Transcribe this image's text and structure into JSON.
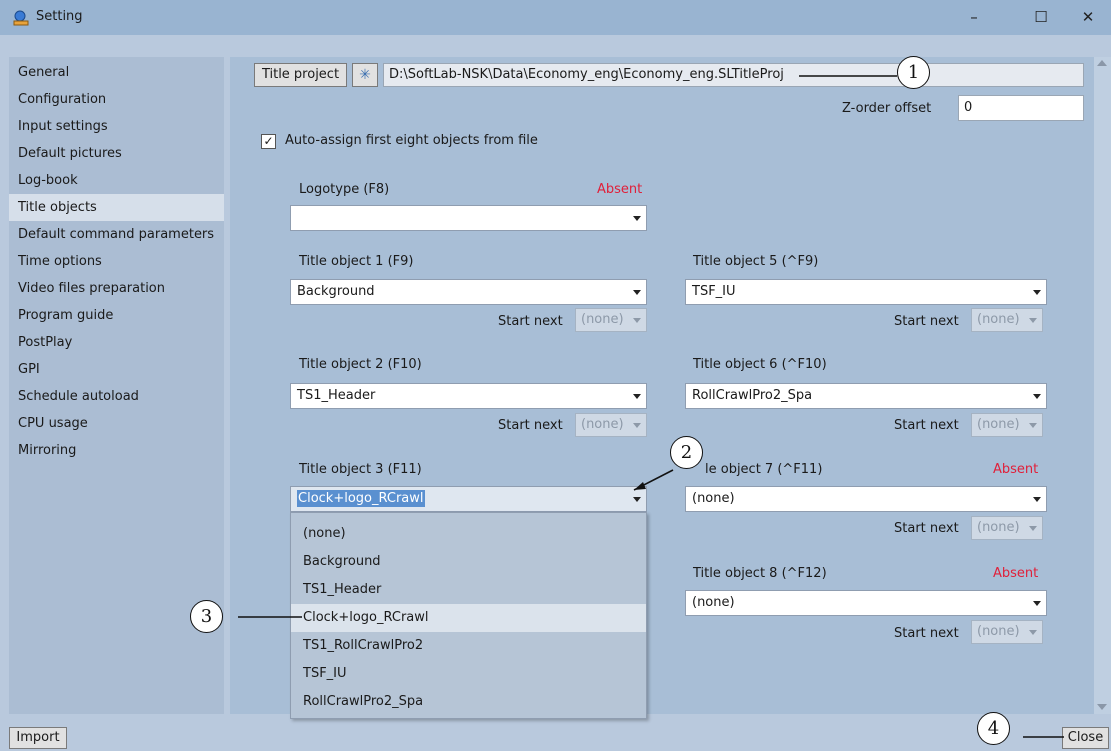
{
  "window": {
    "title": "Setting",
    "minimize": "–",
    "maximize": "☐",
    "close": "✕"
  },
  "nav": {
    "items": [
      {
        "label": "General"
      },
      {
        "label": "Configuration"
      },
      {
        "label": "Input settings"
      },
      {
        "label": "Default pictures"
      },
      {
        "label": "Log-book"
      },
      {
        "label": "Title objects",
        "selected": true
      },
      {
        "label": "Default command parameters"
      },
      {
        "label": "Time options"
      },
      {
        "label": "Video files preparation"
      },
      {
        "label": "Program guide"
      },
      {
        "label": "PostPlay"
      },
      {
        "label": "GPI"
      },
      {
        "label": "Schedule autoload"
      },
      {
        "label": "CPU usage"
      },
      {
        "label": "Mirroring"
      }
    ]
  },
  "project": {
    "button_label": "Title project",
    "icon": "asterisk-icon",
    "path": "D:\\SoftLab-NSK\\Data\\Economy_eng\\Economy_eng.SLTitleProj"
  },
  "zorder": {
    "label": "Z-order offset",
    "value": "0"
  },
  "autoassign": {
    "label": "Auto-assign first eight objects from file",
    "checked": true
  },
  "logotype": {
    "label": "Logotype (F8)",
    "status": "Absent",
    "value": ""
  },
  "objects": {
    "o1": {
      "label": "Title object 1 (F9)",
      "value": "Background"
    },
    "o2": {
      "label": "Title object 2 (F10)",
      "value": "TS1_Header"
    },
    "o3": {
      "label": "Title object 3 (F11)",
      "value": "Clock+logo_RCrawl"
    },
    "o5": {
      "label": "Title object 5 (^F9)",
      "value": "TSF_IU"
    },
    "o6": {
      "label": "Title object 6 (^F10)",
      "value": "RollCrawlPro2_Spa"
    },
    "o7": {
      "label": "le object 7 (^F11)",
      "value": "(none)",
      "status": "Absent"
    },
    "o8": {
      "label": "Title object 8 (^F12)",
      "value": "(none)",
      "status": "Absent"
    }
  },
  "start_next": {
    "label": "Start next",
    "value": "(none)"
  },
  "dropdown": {
    "items": [
      {
        "label": "(none)"
      },
      {
        "label": "Background"
      },
      {
        "label": "TS1_Header"
      },
      {
        "label": "Clock+logo_RCrawl",
        "selected": true
      },
      {
        "label": "TS1_RollCrawlPro2"
      },
      {
        "label": "TSF_IU"
      },
      {
        "label": "RollCrawlPro2_Spa"
      }
    ]
  },
  "footer": {
    "import_label": "Import",
    "close_label": "Close"
  },
  "callouts": {
    "c1": "1",
    "c2": "2",
    "c3": "3",
    "c4": "4"
  },
  "colors": {
    "titlebar": "#99b4d1",
    "frame": "#b9c9dd",
    "content": "#a8bed6",
    "absent": "#e0203a",
    "selection": "#5a90d0"
  }
}
